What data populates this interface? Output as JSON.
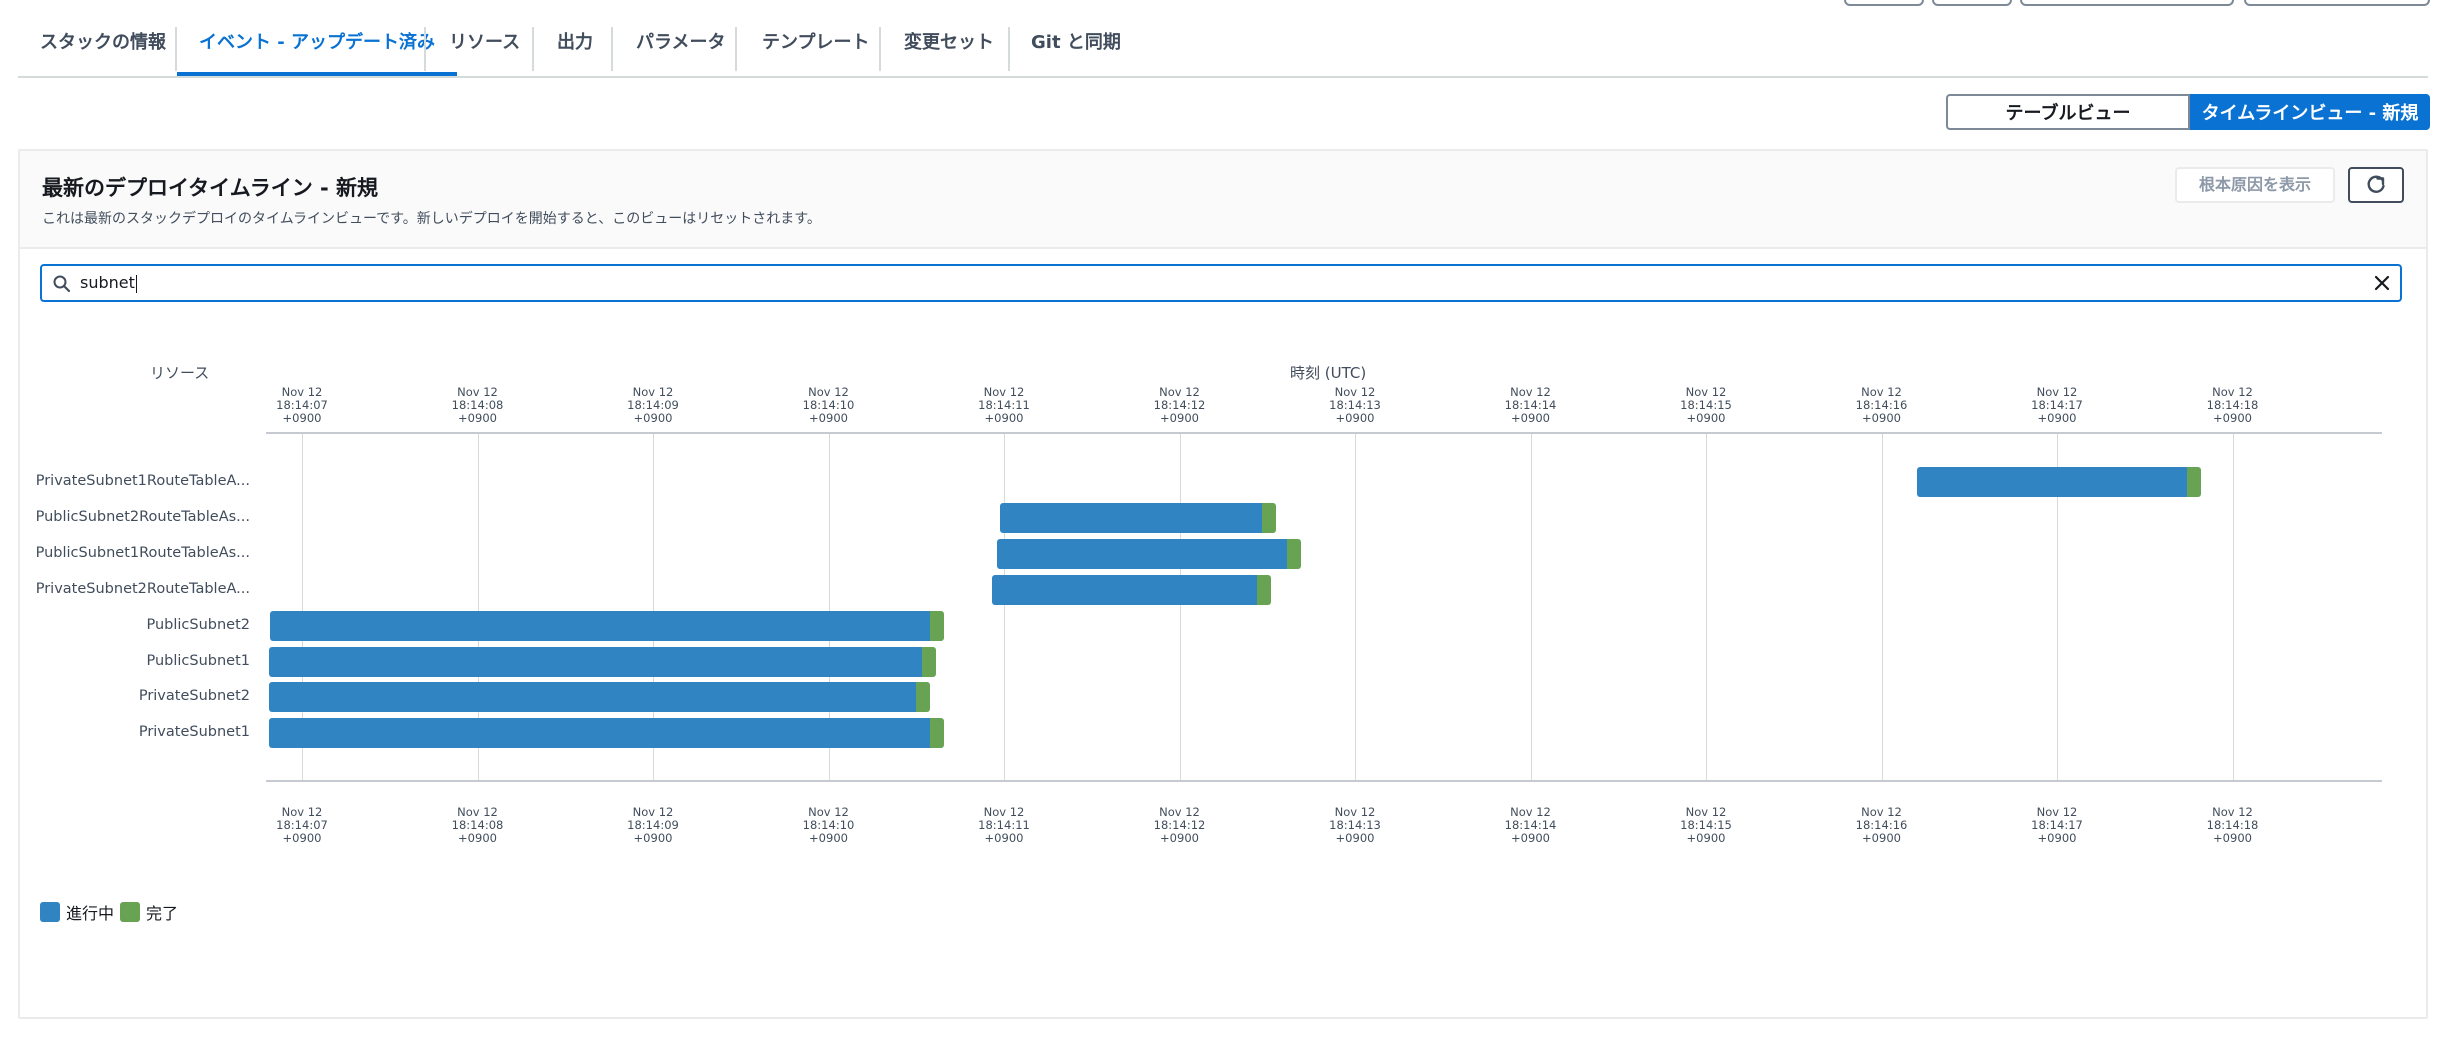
{
  "tabs": [
    {
      "label": "スタックの情報",
      "active": false
    },
    {
      "label": "イベント - アップデート済み",
      "active": true
    },
    {
      "label": "リソース",
      "active": false
    },
    {
      "label": "出力",
      "active": false
    },
    {
      "label": "パラメータ",
      "active": false
    },
    {
      "label": "テンプレート",
      "active": false
    },
    {
      "label": "変更セット",
      "active": false
    },
    {
      "label": "Git と同期",
      "active": false
    }
  ],
  "view_toggle": {
    "table_label": "テーブルビュー",
    "timeline_label": "タイムラインビュー - 新規",
    "selected": "timeline"
  },
  "panel": {
    "title": "最新のデプロイタイムライン - 新規",
    "description": "これは最新のスタックデプロイのタイムラインビューです。新しいデプロイを開始すると、このビューはリセットされます。",
    "root_cause_label": "根本原因を表示",
    "refresh_icon": "refresh-icon"
  },
  "search": {
    "value": "subnet",
    "icon": "search-icon",
    "clear_icon": "close-icon"
  },
  "timeline": {
    "resource_header": "リソース",
    "time_header": "時刻 (UTC)",
    "ticks": [
      {
        "date": "Nov 12",
        "time": "18:14:07",
        "tz": "+0900"
      },
      {
        "date": "Nov 12",
        "time": "18:14:08",
        "tz": "+0900"
      },
      {
        "date": "Nov 12",
        "time": "18:14:09",
        "tz": "+0900"
      },
      {
        "date": "Nov 12",
        "time": "18:14:10",
        "tz": "+0900"
      },
      {
        "date": "Nov 12",
        "time": "18:14:11",
        "tz": "+0900"
      },
      {
        "date": "Nov 12",
        "time": "18:14:12",
        "tz": "+0900"
      },
      {
        "date": "Nov 12",
        "time": "18:14:13",
        "tz": "+0900"
      },
      {
        "date": "Nov 12",
        "time": "18:14:14",
        "tz": "+0900"
      },
      {
        "date": "Nov 12",
        "time": "18:14:15",
        "tz": "+0900"
      },
      {
        "date": "Nov 12",
        "time": "18:14:16",
        "tz": "+0900"
      },
      {
        "date": "Nov 12",
        "time": "18:14:17",
        "tz": "+0900"
      },
      {
        "date": "Nov 12",
        "time": "18:14:18",
        "tz": "+0900"
      }
    ],
    "rows": [
      {
        "label": "PrivateSubnet1RouteTableA...",
        "start": "18:14:16.2",
        "progress_end": "18:14:17.74",
        "complete_end": "18:14:17.82"
      },
      {
        "label": "PublicSubnet2RouteTableAs...",
        "start": "18:14:10.98",
        "progress_end": "18:14:12.47",
        "complete_end": "18:14:12.55"
      },
      {
        "label": "PublicSubnet1RouteTableAs...",
        "start": "18:14:10.96",
        "progress_end": "18:14:12.61",
        "complete_end": "18:14:12.69"
      },
      {
        "label": "PrivateSubnet2RouteTableA...",
        "start": "18:14:10.93",
        "progress_end": "18:14:12.44",
        "complete_end": "18:14:12.52"
      },
      {
        "label": "PublicSubnet2",
        "start": "18:14:06.82",
        "progress_end": "18:14:10.58",
        "complete_end": "18:14:10.66"
      },
      {
        "label": "PublicSubnet1",
        "start": "18:14:06.81",
        "progress_end": "18:14:10.53",
        "complete_end": "18:14:10.61"
      },
      {
        "label": "PrivateSubnet2",
        "start": "18:14:06.81",
        "progress_end": "18:14:10.5",
        "complete_end": "18:14:10.58"
      },
      {
        "label": "PrivateSubnet1",
        "start": "18:14:06.81",
        "progress_end": "18:14:10.58",
        "complete_end": "18:14:10.66"
      }
    ]
  },
  "legend": [
    {
      "label": "進行中",
      "color": "#3184c2"
    },
    {
      "label": "完了",
      "color": "#67a353"
    }
  ]
}
